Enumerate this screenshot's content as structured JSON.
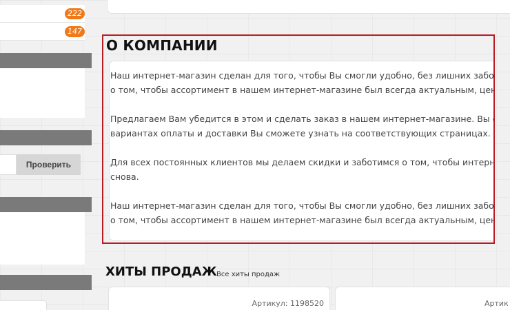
{
  "sidebar": {
    "categories": [
      {
        "count": "222"
      },
      {
        "count": "147"
      }
    ],
    "promo": {
      "check_button_label": "Проверить"
    }
  },
  "about": {
    "title": "О КОМПАНИИ",
    "paragraphs": [
      [
        "Наш интернет-магазин сделан для того, чтобы Вы смогли удобно, без лишних забот",
        "о том, чтобы ассортимент в нашем интернет-магазине был всегда актуальным, цен"
      ],
      [
        "Предлагаем Вам убедится в этом и сделать заказ в нашем интернет-магазине. Вы с",
        "вариантах оплаты и доставки Вы сможете узнать на соответствующих страницах."
      ],
      [
        "Для всех постоянных клиентов мы делаем скидки и заботимся о том, чтобы интерн",
        "снова."
      ],
      [
        "Наш интернет-магазин сделан для того, чтобы Вы смогли удобно, без лишних забот",
        "о том, чтобы ассортимент в нашем интернет-магазине был всегда актуальным, цен"
      ]
    ]
  },
  "hits": {
    "title": "ХИТЫ ПРОДАЖ",
    "all_link": "Все хиты продаж",
    "products": [
      {
        "sku": "Артикул: 1198520"
      },
      {
        "sku": "Артик"
      }
    ]
  },
  "colors": {
    "accent_badge": "#f07a1a",
    "highlight_border": "#b81c24",
    "sidebar_header": "#7a7a7a"
  }
}
